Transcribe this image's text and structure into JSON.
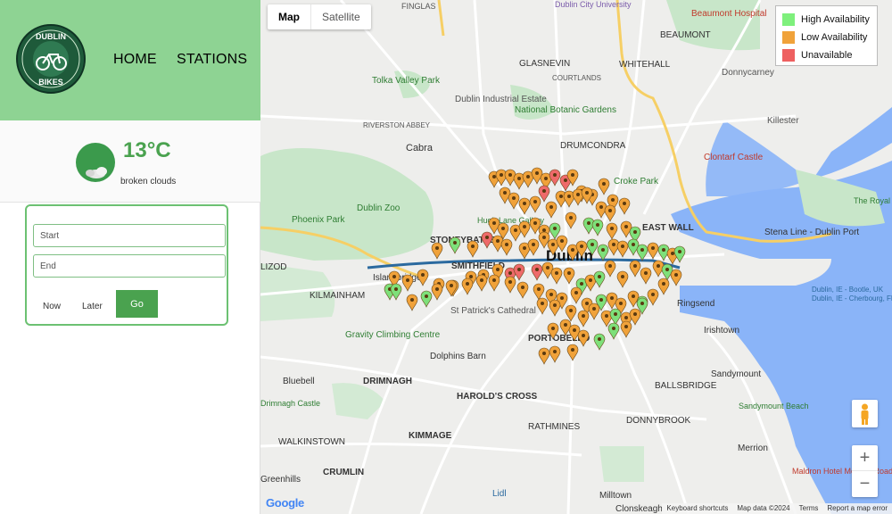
{
  "nav": {
    "home": "HOME",
    "stations": "STATIONS"
  },
  "logo": {
    "text_top": "DUBLIN",
    "text_bottom": "BIKES"
  },
  "weather": {
    "temperature": "13°C",
    "description": "broken clouds",
    "icon": "broken-clouds-icon"
  },
  "planner": {
    "start_placeholder": "Start",
    "end_placeholder": "End",
    "now_label": "Now",
    "later_label": "Later",
    "go_label": "Go"
  },
  "map": {
    "type_options": [
      "Map",
      "Satellite"
    ],
    "selected_type": "Map",
    "legend": [
      {
        "label": "High Availability",
        "color": "#7ef07c"
      },
      {
        "label": "Low Availability",
        "color": "#f0a23a"
      },
      {
        "label": "Unavailable",
        "color": "#ee6060"
      }
    ],
    "marker_colors": {
      "high": "#7ee07a",
      "low": "#f0a23a",
      "unavailable": "#ee6a6a"
    },
    "place_labels": {
      "beaumont_hospital": "Beaumont Hospital",
      "beaumont": "BEAUMONT",
      "whitehall": "WHITEHALL",
      "donnycarney": "Donnycarney",
      "killester": "Killester",
      "glasnevin": "GLASNEVIN",
      "tolka_valley_park": "Tolka Valley Park",
      "dublin_industrial_estate": "Dublin Industrial Estate",
      "national_botanic_gardens": "National Botanic Gardens",
      "cabra": "Cabra",
      "drumcondra": "DRUMCONDRA",
      "croke_park": "Croke Park",
      "clontarf_castle": "Clontarf Castle",
      "phoenix_park": "Phoenix Park",
      "dublin_zoo": "Dublin Zoo",
      "east_wall": "EAST WALL",
      "stena_line": "Stena Line - Dublin Port",
      "stoneybatter": "STONEYBATTER",
      "dublin": "Dublin",
      "smithfield": "SMITHFIELD",
      "islandbridge": "Islandbridge",
      "kilmainham": "KILMAINHAM",
      "st_patricks": "St Patrick's Cathedral",
      "ringsend": "Ringsend",
      "gravity_climbing": "Gravity Climbing Centre",
      "irishtown": "Irishtown",
      "dolphins_barn": "Dolphins Barn",
      "portobello": "PORTOBELLO",
      "bluebell": "Bluebell",
      "drimnagh": "DRIMNAGH",
      "harolds_cross": "HAROLD'S CROSS",
      "sandymount": "Sandymount",
      "ballsbridge": "BALLSBRIDGE",
      "sandymount_beach": "Sandymount Beach",
      "drimnagh_castle": "Drimnagh Castle",
      "donnybrook": "DONNYBROOK",
      "kimmage": "KIMMAGE",
      "rathmines": "RATHMINES",
      "walkinstown": "WALKINSTOWN",
      "crumlin": "CRUMLIN",
      "merrion": "Merrion",
      "maldron_hotel": "Maldron Hotel Merrion Road",
      "lidl": "Lidl",
      "milltown": "Milltown",
      "clonskeagh": "Clonskeagh",
      "finglas": "FINGLAS",
      "dublin_city_university": "Dublin City University",
      "the_royal": "The Royal Dublin Golf C",
      "ferry_bootle": "Dublin, IE - Bootle, UK",
      "ferry_cherbourg": "Dublin, IE - Cherbourg, FR",
      "lizod": "LIZOD",
      "greenhills": "Greenhills",
      "riverston_abbey": "RIVERSTON ABBEY",
      "courtlands": "COURTLANDS",
      "hugh_lane": "Hugh Lane Gallery"
    },
    "google_logo": "Google",
    "attribution": [
      "Keyboard shortcuts",
      "Map data ©2024",
      "Terms",
      "Report a map error"
    ],
    "zoom_in": "+",
    "zoom_out": "−"
  }
}
